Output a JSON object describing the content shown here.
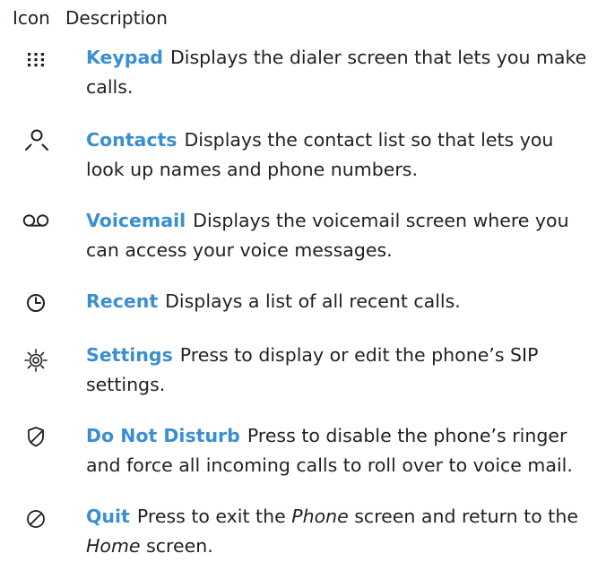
{
  "header": {
    "icon_label": "Icon",
    "description_label": "Description"
  },
  "colors": {
    "accent": "#3a8fd0",
    "text": "#231f20"
  },
  "items": [
    {
      "icon": "keypad-icon",
      "name": "Keypad",
      "description": "Displays the dialer screen that lets you make calls."
    },
    {
      "icon": "contacts-icon",
      "name": "Contacts",
      "description": "Displays the contact list so that lets you look up names and phone numbers."
    },
    {
      "icon": "voicemail-icon",
      "name": "Voicemail",
      "description": "Displays the voicemail screen where you can access your voice messages."
    },
    {
      "icon": "recent-icon",
      "name": "Recent",
      "description": "Displays a list of all recent calls."
    },
    {
      "icon": "settings-icon",
      "name": "Settings",
      "description": "Press to display or edit the phone’s SIP settings."
    },
    {
      "icon": "do-not-disturb-icon",
      "name": "Do Not Disturb",
      "description": "Press to disable the phone’s ringer and force all incoming calls to roll over to voice mail."
    },
    {
      "icon": "quit-icon",
      "name": "Quit",
      "description_part1": "Press to exit the ",
      "description_em1": "Phone",
      "description_part2": " screen and return to the ",
      "description_em2": "Home",
      "description_part3": " screen."
    }
  ]
}
